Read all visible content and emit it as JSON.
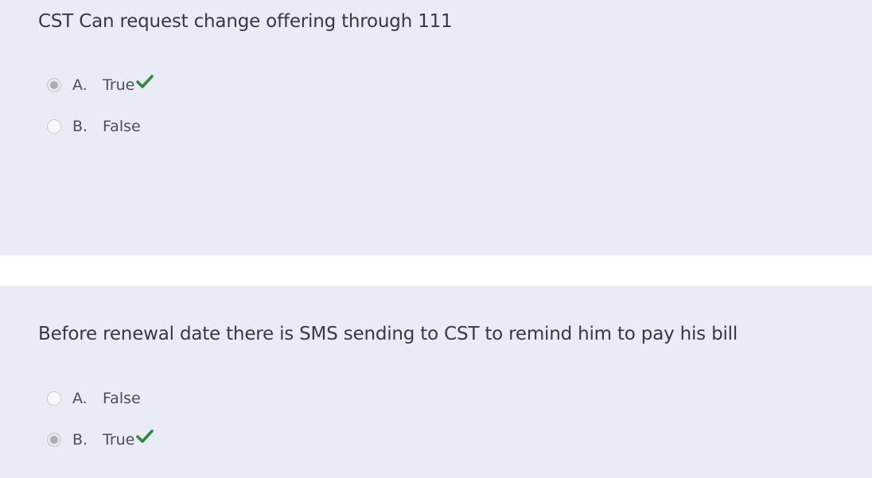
{
  "questions": [
    {
      "text": "CST Can request change offering through 111",
      "options": [
        {
          "letter": "A.",
          "label": "True",
          "selected": true,
          "correct": true
        },
        {
          "letter": "B.",
          "label": "False",
          "selected": false,
          "correct": false
        }
      ]
    },
    {
      "text": "Before renewal date there is SMS sending to CST to remind him to pay his bill",
      "options": [
        {
          "letter": "A.",
          "label": "False",
          "selected": false,
          "correct": false
        },
        {
          "letter": "B.",
          "label": "True",
          "selected": true,
          "correct": true
        }
      ]
    }
  ],
  "icons": {
    "correct_mark": "checkmark-icon"
  },
  "colors": {
    "card_background": "#e9ecf6",
    "checkmark": "#2e8b3a",
    "text": "#343a40"
  }
}
